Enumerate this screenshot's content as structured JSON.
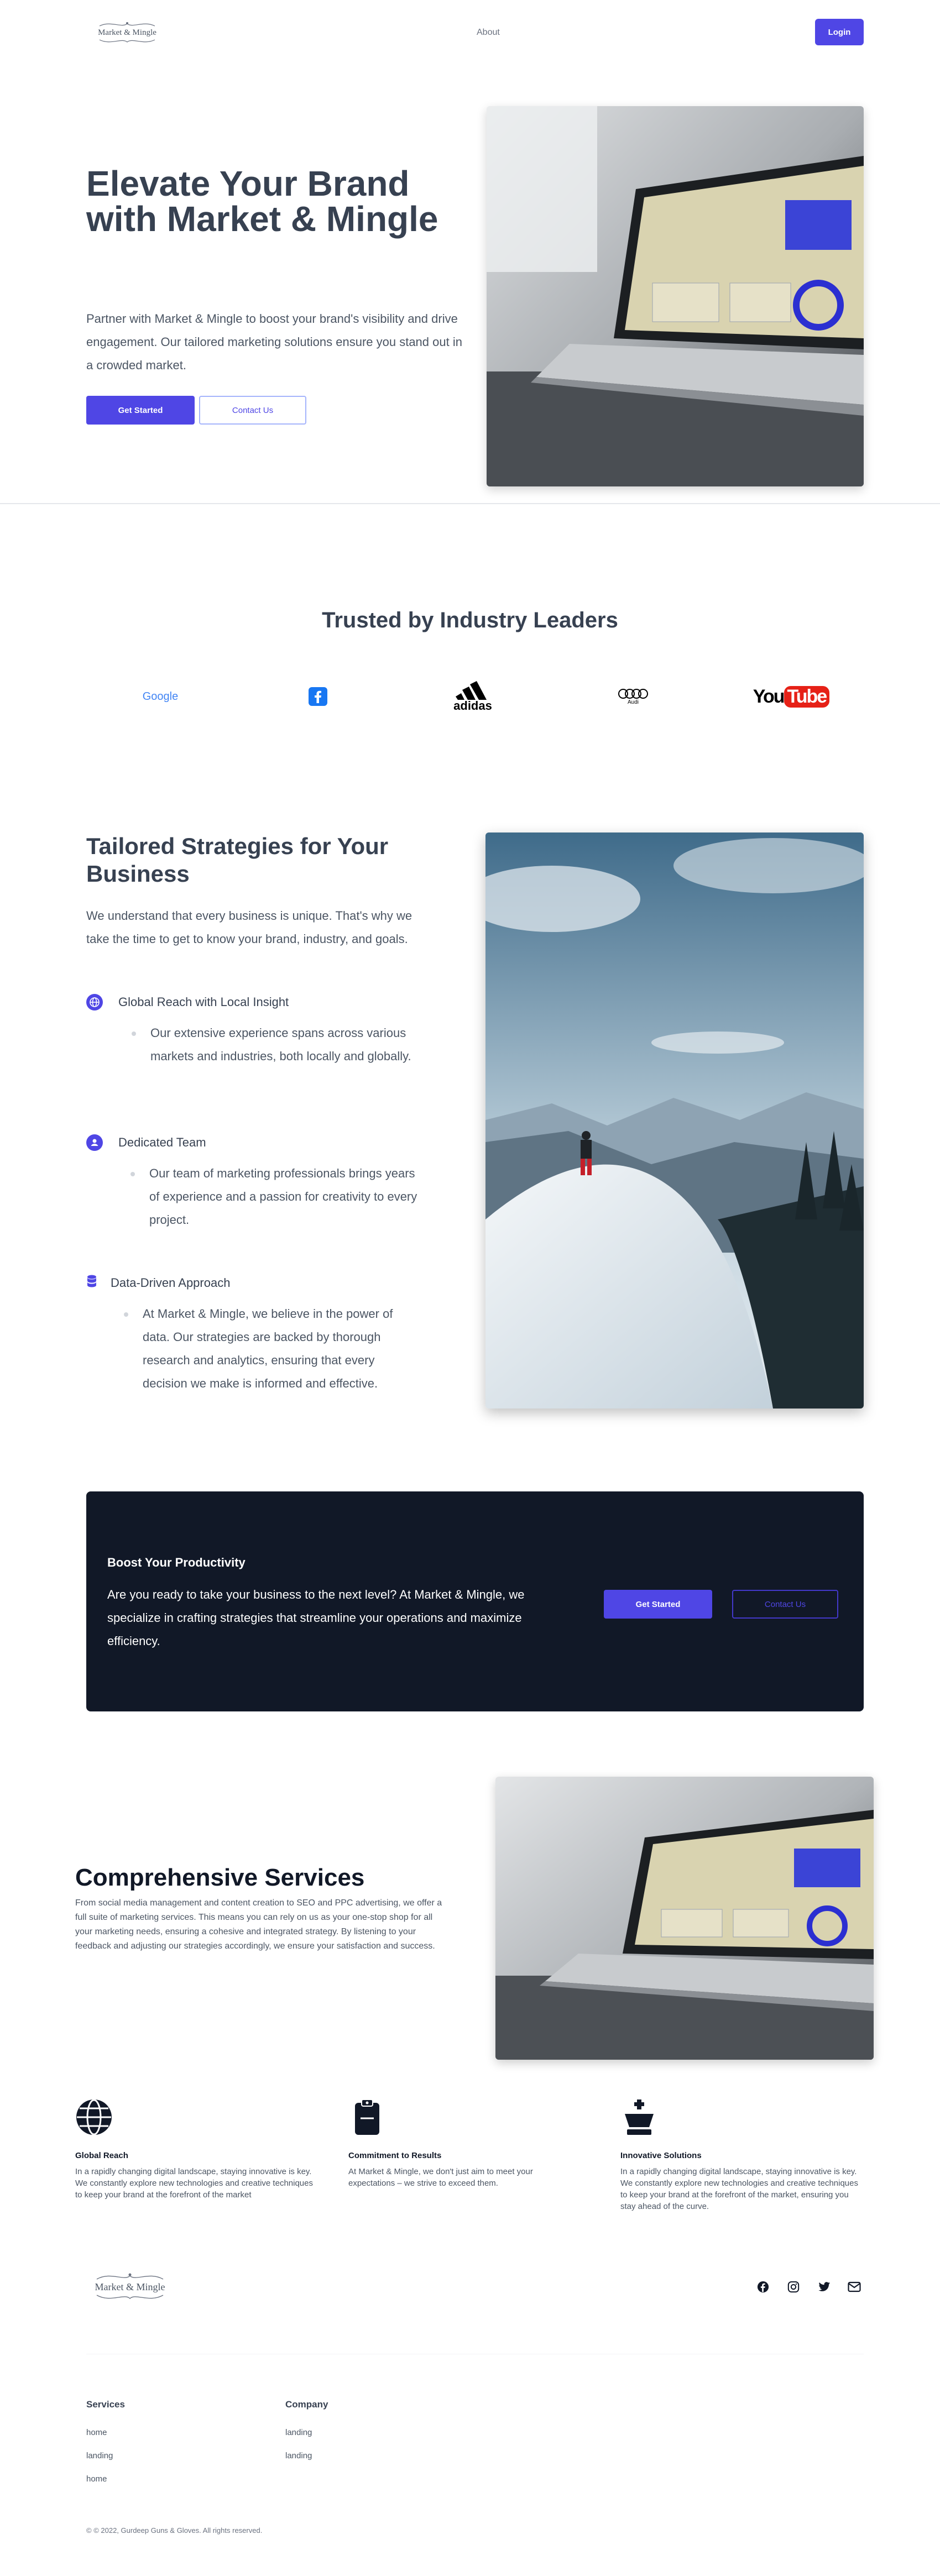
{
  "nav": {
    "logo_text": "Market & Mingle",
    "about_label": "About",
    "login_label": "Login"
  },
  "hero": {
    "title": "Elevate Your Brand with Market & Mingle",
    "text": "Partner with Market & Mingle to boost your brand's visibility and drive engagement. Our tailored marketing solutions ensure you stand out in a crowded market.",
    "get_started_label": "Get Started",
    "contact_label": "Contact Us"
  },
  "trusted": {
    "title": "Trusted by Industry Leaders",
    "brands": [
      "Google",
      "facebook-icon",
      "adidas",
      "Audi",
      "YouTube"
    ],
    "google_text": "Google",
    "adidas_text": "adidas",
    "audi_text": "Audi",
    "youtube_you": "You",
    "youtube_tube": "Tube"
  },
  "strategies": {
    "title": "Tailored Strategies for Your Business",
    "intro": "We understand that every business is unique. That's why we take the time to get to know your brand, industry, and goals.",
    "features": [
      {
        "icon": "globe-icon",
        "title": "Global Reach with Local Insight",
        "text": "Our extensive experience spans across various markets and industries, both locally and globally."
      },
      {
        "icon": "user-circle-icon",
        "title": "Dedicated Team",
        "text": "Our team of marketing professionals brings years of experience and a passion for creativity to every project."
      },
      {
        "icon": "database-icon",
        "title": "Data-Driven Approach",
        "text": "At Market & Mingle, we believe in the power of data. Our strategies are backed by thorough research and analytics, ensuring that every decision we make is informed and effective."
      }
    ]
  },
  "cta": {
    "title": "Boost Your Productivity",
    "text": "Are you ready to take your business to the next level? At Market & Mingle, we specialize in crafting strategies that streamline your operations and maximize efficiency.",
    "get_started_label": "Get Started",
    "contact_label": "Contact Us"
  },
  "services": {
    "title": "Comprehensive Services",
    "text": "From social media management and content creation to SEO and PPC advertising, we offer a full suite of marketing services. This means you can rely on us as your one-stop shop for all your marketing needs, ensuring a cohesive and integrated strategy. By listening to your feedback and adjusting our strategies accordingly, we ensure your satisfaction and success.",
    "columns": [
      {
        "icon": "globe-icon",
        "title": "Global Reach",
        "text": "In a rapidly changing digital landscape, staying innovative is key. We constantly explore new technologies and creative techniques to keep your brand at the forefront of the market"
      },
      {
        "icon": "clipboard-icon",
        "title": "Commitment to Results",
        "text": "At Market & Mingle, we don't just aim to meet your expectations – we strive to exceed them."
      },
      {
        "icon": "chess-king-icon",
        "title": "Innovative Solutions",
        "text": "In a rapidly changing digital landscape, staying innovative is key. We constantly explore new technologies and creative techniques to keep your brand at the forefront of the market, ensuring you stay ahead of the curve."
      }
    ]
  },
  "footer": {
    "logo_text": "Market & Mingle",
    "social": [
      "facebook-icon",
      "instagram-icon",
      "twitter-icon",
      "mail-icon"
    ],
    "services_heading": "Services",
    "services_links": [
      "home",
      "landing",
      "home"
    ],
    "company_heading": "Company",
    "company_links": [
      "landing",
      "landing"
    ],
    "copyright": "© © 2022, Gurdeep Guns & Gloves. All rights reserved."
  },
  "colors": {
    "accent": "#4f46e5",
    "dark_panel": "#111827",
    "heading": "#374151",
    "youtube_red": "#e62117"
  }
}
